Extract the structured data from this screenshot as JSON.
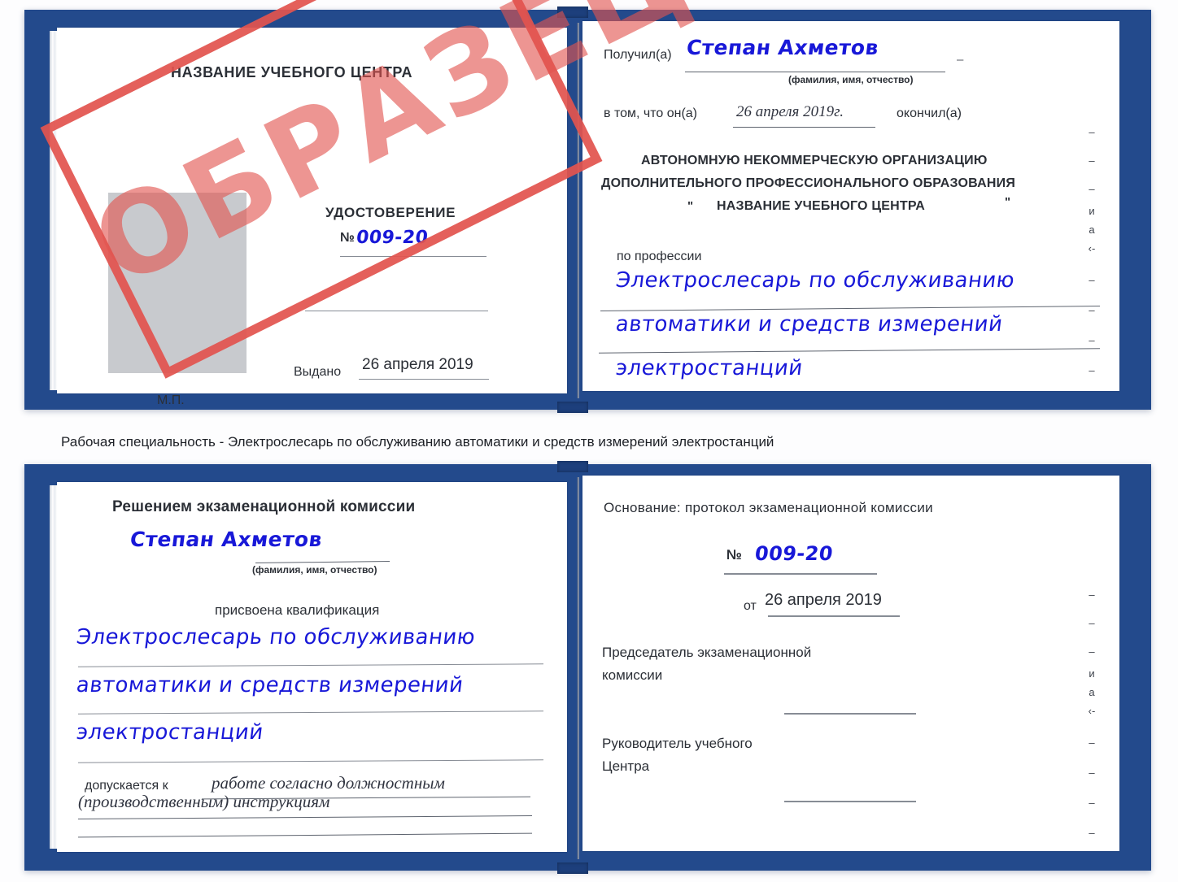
{
  "caption": "Рабочая специальность - Электрослесарь по обслуживанию автоматики и средств измерений электростанций",
  "stamp": {
    "text": "ОБРАЗЕЦ",
    "color": "#e2544f"
  },
  "certificate_top": {
    "left_page": {
      "center_title": "НАЗВАНИЕ УЧЕБНОГО ЦЕНТРА",
      "doc_type": "УДОСТОВЕРЕНИЕ",
      "number_label": "№",
      "number_value": "009-20",
      "issued_label": "Выдано",
      "issued_value": "26 апреля 2019",
      "seal_label": "М.П."
    },
    "right_page": {
      "received_label": "Получил(а)",
      "received_value": "Степан Ахметов",
      "fio_hint": "(фамилия, имя, отчество)",
      "that_he_label": "в том, что он(а)",
      "finish_date": "26 апреля 2019г.",
      "finished_label": "окончил(а)",
      "org_line1": "АВТОНОМНУЮ НЕКОММЕРЧЕСКУЮ ОРГАНИЗАЦИЮ",
      "org_line2": "ДОПОЛНИТЕЛЬНОГО ПРОФЕССИОНАЛЬНОГО ОБРАЗОВАНИЯ",
      "org_quote_open": "\"",
      "org_line3": "НАЗВАНИЕ УЧЕБНОГО ЦЕНТРА",
      "org_quote_close": "\"",
      "profession_label": "по профессии",
      "profession_line1": "Электрослесарь по обслуживанию",
      "profession_line2": "автоматики и средств измерений",
      "profession_line3": "электростанций",
      "edge_scraps": [
        "–",
        "–",
        "–",
        "и",
        "а",
        "‹-",
        "–",
        "–",
        "–",
        "–"
      ]
    }
  },
  "certificate_bottom": {
    "left_page": {
      "heading": "Решением экзаменационной комиссии",
      "name_value": "Степан Ахметов",
      "fio_hint": "(фамилия, имя, отчество)",
      "qualification_label": "присвоена квалификация",
      "qualification_line1": "Электрослесарь по обслуживанию",
      "qualification_line2": "автоматики и средств измерений",
      "qualification_line3": "электростанций",
      "admitted_label": "допускается к",
      "admitted_value_line1": "работе согласно должностным",
      "admitted_value_line2": "(производственным) инструкциям"
    },
    "right_page": {
      "basis_label": "Основание: протокол экзаменационной комиссии",
      "number_label": "№",
      "number_value": "009-20",
      "date_label": "от",
      "date_value": "26 апреля 2019",
      "chairman_line1": "Председатель экзаменационной",
      "chairman_line2": "комиссии",
      "head_line1": "Руководитель учебного",
      "head_line2": "Центра",
      "edge_scraps": [
        "–",
        "–",
        "–",
        "и",
        "а",
        "‹-",
        "–",
        "–",
        "–",
        "–"
      ]
    }
  }
}
